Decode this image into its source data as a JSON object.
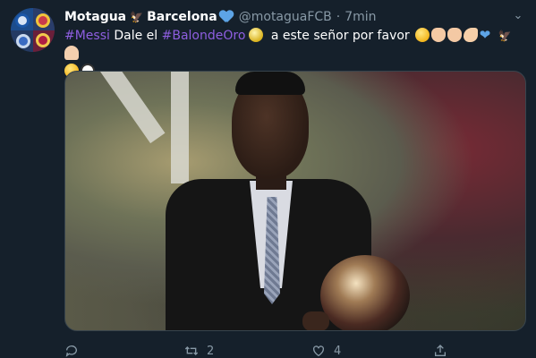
{
  "tweet": {
    "display_name": "Motagua",
    "display_name_2": "Barcelona",
    "handle": "@motaguaFCB",
    "separator": "·",
    "time": "7min",
    "text_hashtag_1": "#Messi",
    "text_part_1": " Dale el ",
    "text_hashtag_2": "#BalondeOro",
    "text_part_2": " a este señor por favor",
    "media_alt": "",
    "actions": {
      "reply_count": "",
      "retweet_count": "2",
      "like_count": "4"
    }
  },
  "icons": {
    "avatar": "avatar-icon",
    "eagle": "eagle-icon",
    "heart": "blue-heart-icon",
    "chevron": "chevron-down-icon",
    "reply": "reply-icon",
    "retweet": "retweet-icon",
    "like": "like-icon",
    "share": "share-icon"
  },
  "colors": {
    "background": "#15202b",
    "hashtag": "#8e5ee0",
    "secondary_text": "#8899a6",
    "heart": "#5da4e6"
  }
}
